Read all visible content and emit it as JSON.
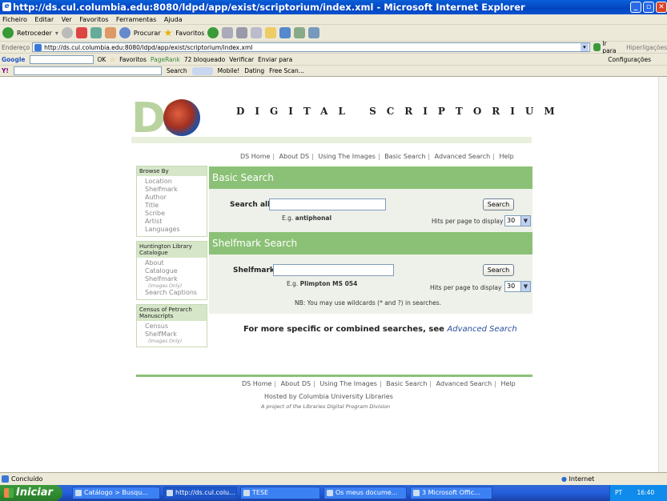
{
  "window": {
    "title": "http://ds.cul.columbia.edu:8080/ldpd/app/exist/scriptorium/index.xml - Microsoft Internet Explorer"
  },
  "menu": [
    "Ficheiro",
    "Editar",
    "Ver",
    "Favoritos",
    "Ferramentas",
    "Ajuda"
  ],
  "toolbar": {
    "back": "Retroceder",
    "search": "Procurar",
    "favorites": "Favoritos"
  },
  "address": {
    "label": "Endereço",
    "url": "http://ds.cul.columbia.edu:8080/ldpd/app/exist/scriptorium/index.xml",
    "go": "Ir para",
    "links": "Hiperligações"
  },
  "googlebar": {
    "label": "Google",
    "ok": "OK",
    "favorites": "Favoritos",
    "pagerank": "PageRank",
    "blocked": "72 bloqueado",
    "check": "Verificar",
    "send": "Enviar para",
    "settings": "Configurações"
  },
  "yahoobar": {
    "search": "Search",
    "mobile": "Mobile!",
    "dating": "Dating",
    "freescan": "Free Scan..."
  },
  "site": {
    "logo_text": "DS",
    "title": "DIGITAL SCRIPTORIUM",
    "nav": [
      "DS Home",
      "About DS",
      "Using The Images",
      "Basic Search",
      "Advanced Search",
      "Help"
    ]
  },
  "sidebar": [
    {
      "head": "Browse By",
      "items": [
        {
          "label": "Location"
        },
        {
          "label": "Shelfmark"
        },
        {
          "label": "Author"
        },
        {
          "label": "Title"
        },
        {
          "label": "Scribe"
        },
        {
          "label": "Artist"
        },
        {
          "label": "Languages"
        }
      ]
    },
    {
      "head": "Huntington Library Catalogue",
      "items": [
        {
          "label": "About"
        },
        {
          "label": "Catalogue"
        },
        {
          "label": "Shelfmark",
          "sub": "(Images Only)"
        },
        {
          "label": "Search Captions"
        }
      ]
    },
    {
      "head": "Census of Petrarch Manuscripts",
      "items": [
        {
          "label": "Census"
        },
        {
          "label": "ShelfMark",
          "sub": "(Images Only)"
        }
      ]
    }
  ],
  "basic": {
    "heading": "Basic Search",
    "label": "Search all:",
    "value": "",
    "eg_prefix": "E.g.",
    "eg_value": "antiphonal",
    "button": "Search",
    "hits_label": "Hits per page to display",
    "hits_value": "30"
  },
  "shelf": {
    "heading": "Shelfmark Search",
    "label": "Shelfmark:",
    "value": "",
    "eg_prefix": "E.g.",
    "eg_value": "Plimpton MS 054",
    "button": "Search",
    "hits_label": "Hits per page to display",
    "hits_value": "30",
    "note": "NB: You may use wildcards (* and ?) in searches."
  },
  "more": {
    "text": "For more specific or combined searches, see",
    "link": "Advanced Search"
  },
  "footer": {
    "hosted": "Hosted by Columbia University Libraries",
    "project": "A project of the Libraries Digital Program Division"
  },
  "status": {
    "left": "Concluído",
    "zone": "Internet"
  },
  "taskbar": {
    "start": "Iniciar",
    "tasks": [
      "Catálogo > Busqu...",
      "http://ds.cul.colu...",
      "TESE",
      "Os meus docume...",
      "3 Microsoft Offic..."
    ],
    "lang": "PT",
    "clock": "16:40"
  }
}
